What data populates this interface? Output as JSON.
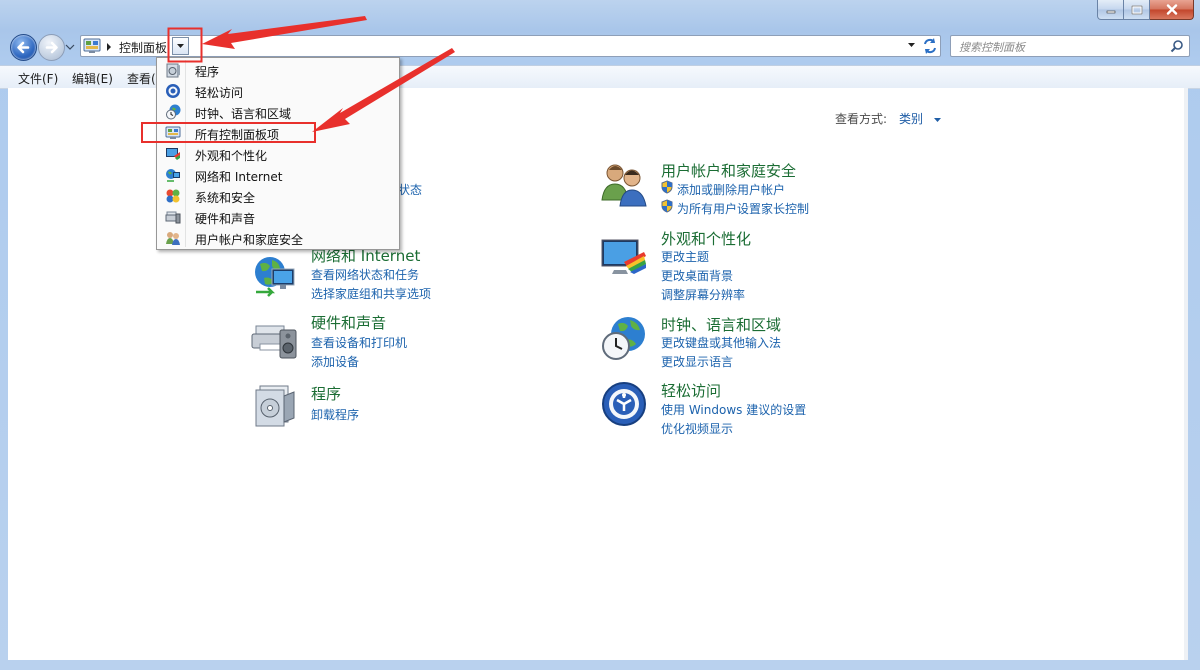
{
  "window": {
    "address": {
      "crumb": "控制面板"
    },
    "search": {
      "placeholder": "搜索控制面板"
    },
    "menubar": {
      "file": "文件(F)",
      "edit": "编辑(E)",
      "view": "查看("
    }
  },
  "viewby": {
    "label": "查看方式:",
    "value": "类别"
  },
  "dropdown": {
    "items": [
      {
        "label": "程序",
        "icon": "programs-icon"
      },
      {
        "label": "轻松访问",
        "icon": "ease-of-access-icon"
      },
      {
        "label": "时钟、语言和区域",
        "icon": "clock-globe-icon"
      },
      {
        "label": "所有控制面板项",
        "icon": "control-panel-icon"
      },
      {
        "label": "外观和个性化",
        "icon": "appearance-icon"
      },
      {
        "label": "网络和 Internet",
        "icon": "network-icon"
      },
      {
        "label": "系统和安全",
        "icon": "system-security-icon"
      },
      {
        "label": "硬件和声音",
        "icon": "hardware-icon"
      },
      {
        "label": "用户帐户和家庭安全",
        "icon": "users-icon"
      }
    ]
  },
  "categories": {
    "system_security": {
      "partial_link": "状态"
    },
    "network": {
      "title": "网络和 Internet",
      "links": [
        "查看网络状态和任务",
        "选择家庭组和共享选项"
      ]
    },
    "hardware": {
      "title": "硬件和声音",
      "links": [
        "查看设备和打印机",
        "添加设备"
      ]
    },
    "programs": {
      "title": "程序",
      "links": [
        "卸载程序"
      ]
    },
    "users": {
      "title": "用户帐户和家庭安全",
      "links": [
        "添加或删除用户帐户",
        "为所有用户设置家长控制"
      ]
    },
    "appearance": {
      "title": "外观和个性化",
      "links": [
        "更改主题",
        "更改桌面背景",
        "调整屏幕分辨率"
      ]
    },
    "clock": {
      "title": "时钟、语言和区域",
      "links": [
        "更改键盘或其他输入法",
        "更改显示语言"
      ]
    },
    "ease": {
      "title": "轻松访问",
      "links": [
        "使用 Windows 建议的设置",
        "优化视频显示"
      ]
    }
  },
  "colors": {
    "title_green": "#1b6d34",
    "link_blue": "#1d63ad",
    "annotation_red": "#e8302c"
  }
}
